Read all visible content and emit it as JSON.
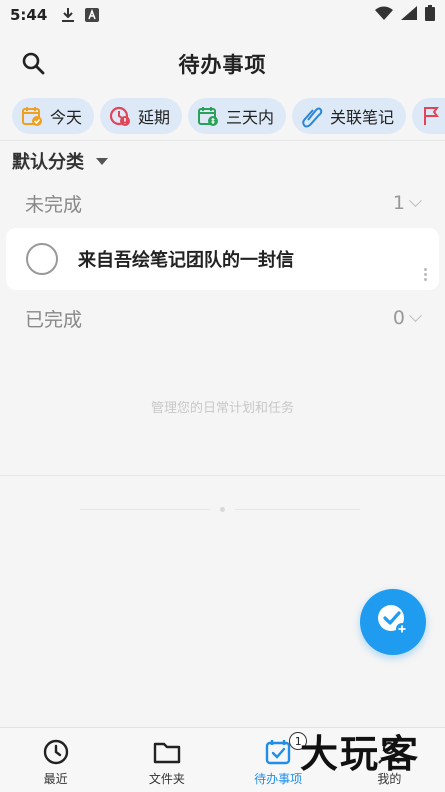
{
  "status_bar": {
    "time": "5:44",
    "icons": [
      "download-icon",
      "notification-a-icon",
      "wifi-icon",
      "signal-icon",
      "battery-icon"
    ]
  },
  "header": {
    "title": "待办事项",
    "search_icon": "search-icon"
  },
  "filter_chips": [
    {
      "label": "今天",
      "icon": "calendar-check-icon"
    },
    {
      "label": "延期",
      "icon": "alarm-clock-icon"
    },
    {
      "label": "三天内",
      "icon": "calendar-money-icon"
    },
    {
      "label": "关联笔记",
      "icon": "paperclip-icon"
    }
  ],
  "category": {
    "label": "默认分类"
  },
  "sections": {
    "incomplete": {
      "label": "未完成",
      "count": "1"
    },
    "complete": {
      "label": "已完成",
      "count": "0"
    }
  },
  "tasks": [
    {
      "text": "来自吾绘笔记团队的一封信",
      "done": false
    }
  ],
  "hint_text": "管理您的日常计划和任务",
  "fab": {
    "icon": "add-task-check-icon"
  },
  "bottom_nav": [
    {
      "label": "最近",
      "icon": "clock-icon",
      "active": false
    },
    {
      "label": "文件夹",
      "icon": "folder-icon",
      "active": false
    },
    {
      "label": "待办事项",
      "icon": "todo-calendar-icon",
      "active": true,
      "badge": "1"
    },
    {
      "label": "我的",
      "icon": "profile-icon",
      "active": false
    }
  ],
  "watermark": "大玩客",
  "colors": {
    "accent": "#1f9bf0",
    "chip_bg": "#dde9f7",
    "background": "#f5f5f5"
  }
}
